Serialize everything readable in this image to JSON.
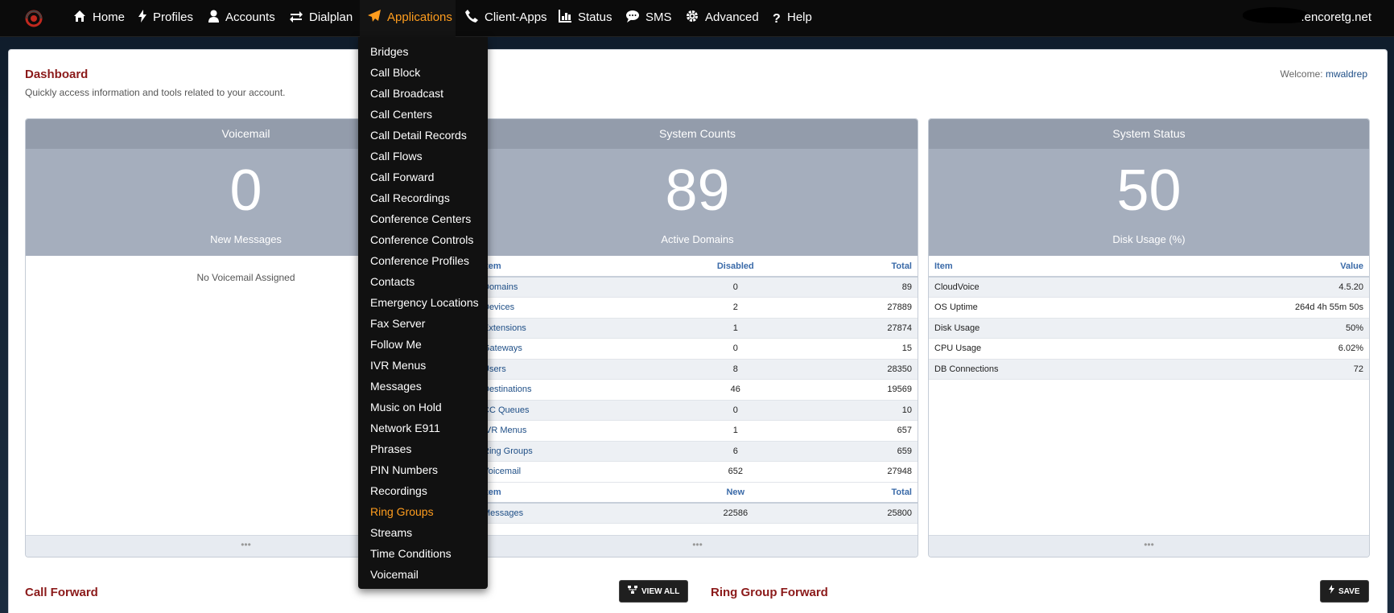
{
  "nav": {
    "items": [
      {
        "label": "Home",
        "icon": "home-icon"
      },
      {
        "label": "Profiles",
        "icon": "bolt-icon"
      },
      {
        "label": "Accounts",
        "icon": "user-icon"
      },
      {
        "label": "Dialplan",
        "icon": "exchange-icon"
      },
      {
        "label": "Applications",
        "icon": "paper-plane-icon"
      },
      {
        "label": "Client-Apps",
        "icon": "phone-icon"
      },
      {
        "label": "Status",
        "icon": "bar-chart-icon"
      },
      {
        "label": "SMS",
        "icon": "chat-bubble-icon"
      },
      {
        "label": "Advanced",
        "icon": "gear-icon"
      },
      {
        "label": "Help",
        "icon": "question-icon"
      }
    ],
    "active": "Applications",
    "domain": ".encoretg.net",
    "active_color": "#ff9d1e"
  },
  "applications_menu": {
    "items": [
      "Bridges",
      "Call Block",
      "Call Broadcast",
      "Call Centers",
      "Call Detail Records",
      "Call Flows",
      "Call Forward",
      "Call Recordings",
      "Conference Centers",
      "Conference Controls",
      "Conference Profiles",
      "Contacts",
      "Emergency Locations",
      "Fax Server",
      "Follow Me",
      "IVR Menus",
      "Messages",
      "Music on Hold",
      "Network E911",
      "Phrases",
      "PIN Numbers",
      "Recordings",
      "Ring Groups",
      "Streams",
      "Time Conditions",
      "Voicemail"
    ],
    "highlighted": "Ring Groups"
  },
  "dashboard": {
    "title": "Dashboard",
    "subtitle": "Quickly access information and tools related to your account.",
    "welcome_label": "Welcome:",
    "username": "mwaldrep"
  },
  "voicemail": {
    "title": "Voicemail",
    "count": "0",
    "caption": "New Messages",
    "empty_text": "No Voicemail Assigned"
  },
  "system_counts": {
    "title": "System Counts",
    "count": "89",
    "caption": "Active Domains",
    "headers": [
      "Item",
      "Disabled",
      "Total"
    ],
    "rows": [
      [
        "Domains",
        "0",
        "89"
      ],
      [
        "Devices",
        "2",
        "27889"
      ],
      [
        "Extensions",
        "1",
        "27874"
      ],
      [
        "Gateways",
        "0",
        "15"
      ],
      [
        "Users",
        "8",
        "28350"
      ],
      [
        "Destinations",
        "46",
        "19569"
      ],
      [
        "CC Queues",
        "0",
        "10"
      ],
      [
        "IVR Menus",
        "1",
        "657"
      ],
      [
        "Ring Groups",
        "6",
        "659"
      ],
      [
        "Voicemail",
        "652",
        "27948"
      ]
    ],
    "headers2": [
      "Item",
      "New",
      "Total"
    ],
    "rows2": [
      [
        "Messages",
        "22586",
        "25800"
      ]
    ]
  },
  "system_status": {
    "title": "System Status",
    "count": "50",
    "caption": "Disk Usage (%)",
    "headers": [
      "Item",
      "Value"
    ],
    "rows": [
      [
        "CloudVoice",
        "4.5.20"
      ],
      [
        "OS Uptime",
        "264d 4h 55m 50s"
      ],
      [
        "Disk Usage",
        "50%"
      ],
      [
        "CPU Usage",
        "6.02%"
      ],
      [
        "DB Connections",
        "72"
      ]
    ]
  },
  "footer_dots": "•••",
  "call_forward": {
    "title": "Call Forward",
    "view_all_label": "VIEW ALL"
  },
  "ring_group_forward": {
    "title": "Ring Group Forward",
    "save_label": "SAVE"
  }
}
